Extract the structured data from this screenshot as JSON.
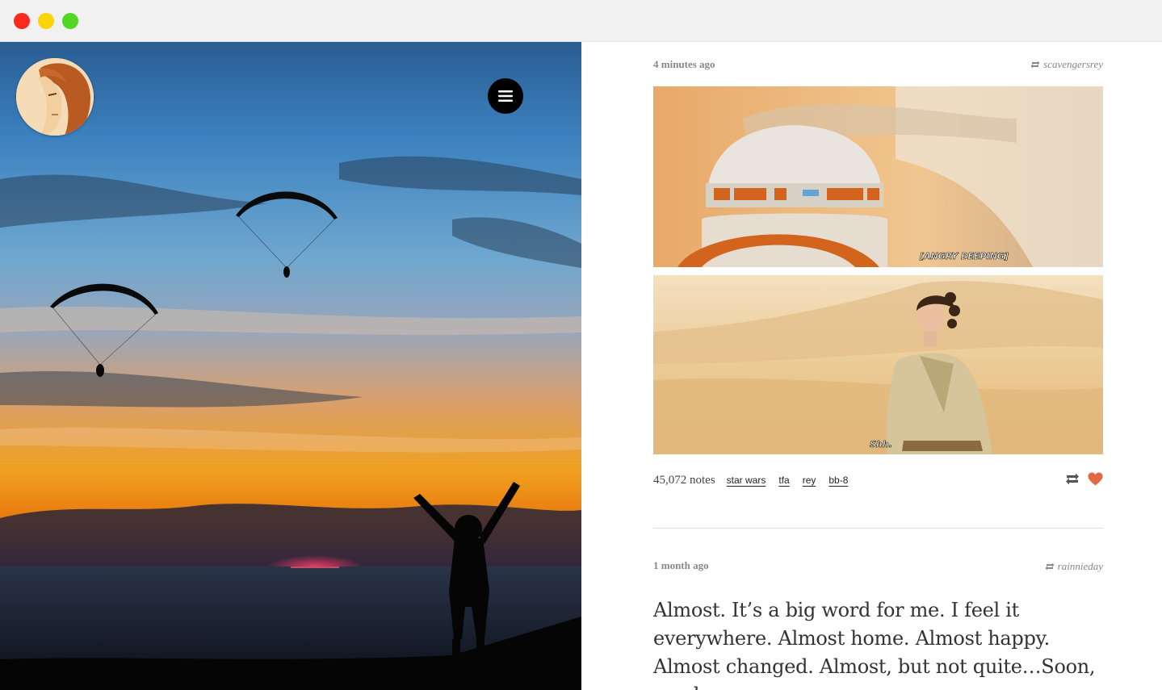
{
  "window": {
    "buttons": [
      "close",
      "minimize",
      "maximize"
    ]
  },
  "hero": {
    "avatar_icon": "avatar-girl-portrait",
    "menu_icon": "hamburger-menu-icon"
  },
  "posts": [
    {
      "time": "4 minutes ago",
      "reblogged_from": "scavengersrey",
      "images": [
        {
          "caption": "[ANGRY BEEPING]"
        },
        {
          "caption": "Shh."
        }
      ],
      "notes": "45,072 notes",
      "tags": [
        "star wars",
        "tfa",
        "rey",
        "bb-8"
      ],
      "actions": [
        "reblog-icon",
        "heart-icon"
      ]
    },
    {
      "time": "1 month ago",
      "reblogged_from": "rainnieday",
      "text": "Almost. It’s a big word for me. I feel it everywhere. Almost home. Almost happy. Almost changed. Almost, but not quite…Soon, maybe."
    }
  ],
  "colors": {
    "heart": "#e16a3e",
    "chrome_bg": "#f1f1f1",
    "close": "#fb2a1f",
    "minimize": "#fbd404",
    "maximize": "#52d624"
  }
}
